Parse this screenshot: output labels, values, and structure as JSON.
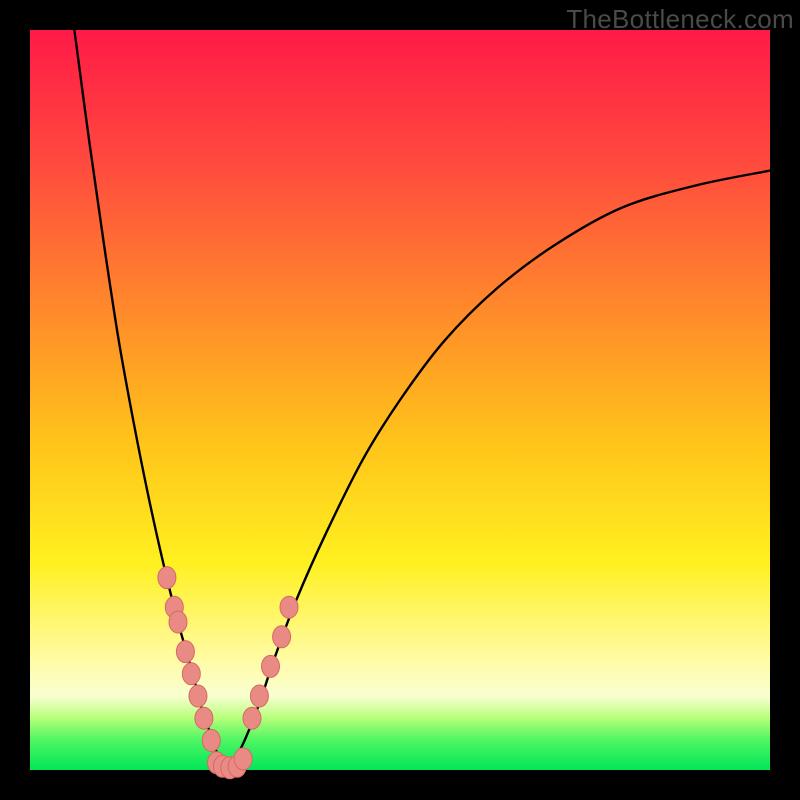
{
  "watermark": "TheBottleneck.com",
  "colors": {
    "curve_stroke": "#000000",
    "marker_fill": "#e98b84",
    "marker_stroke": "#d46a63",
    "gradient_top": "#ff1a47",
    "gradient_bottom": "#00e759"
  },
  "chart_data": {
    "type": "line",
    "title": "",
    "xlabel": "",
    "ylabel": "",
    "xlim": [
      0,
      100
    ],
    "ylim": [
      0,
      100
    ],
    "optimum_x_percent": 27,
    "note": "V-shaped bottleneck curve; y = 0 at optimum, rises steeply on both sides. Pink markers cluster near the valley on both arms; y read as percent of plot height from bottom.",
    "curve_left": {
      "x": [
        6,
        8,
        10,
        12,
        14,
        16,
        18,
        20,
        22,
        23,
        24,
        25,
        26,
        27
      ],
      "y": [
        100,
        85,
        71,
        58,
        47,
        37,
        28,
        20,
        13,
        9,
        6,
        3,
        1,
        0
      ]
    },
    "curve_right": {
      "x": [
        27,
        29,
        31,
        33,
        36,
        40,
        45,
        50,
        56,
        63,
        71,
        80,
        90,
        100
      ],
      "y": [
        0,
        4,
        9,
        15,
        23,
        32,
        42,
        50,
        58,
        65,
        71,
        76,
        79,
        81
      ]
    },
    "series": [
      {
        "name": "left-arm-markers",
        "x": [
          18.5,
          19.5,
          20.0,
          21.0,
          21.8,
          22.7,
          23.5,
          24.5
        ],
        "y": [
          26,
          22,
          20,
          16,
          13,
          10,
          7,
          4
        ]
      },
      {
        "name": "valley-markers",
        "x": [
          25.2,
          26.0,
          27.0,
          28.0,
          28.8
        ],
        "y": [
          1,
          0.5,
          0.3,
          0.5,
          1.5
        ]
      },
      {
        "name": "right-arm-markers",
        "x": [
          30.0,
          31.0,
          32.5,
          34.0,
          35.0
        ],
        "y": [
          7,
          10,
          14,
          18,
          22
        ]
      }
    ]
  }
}
